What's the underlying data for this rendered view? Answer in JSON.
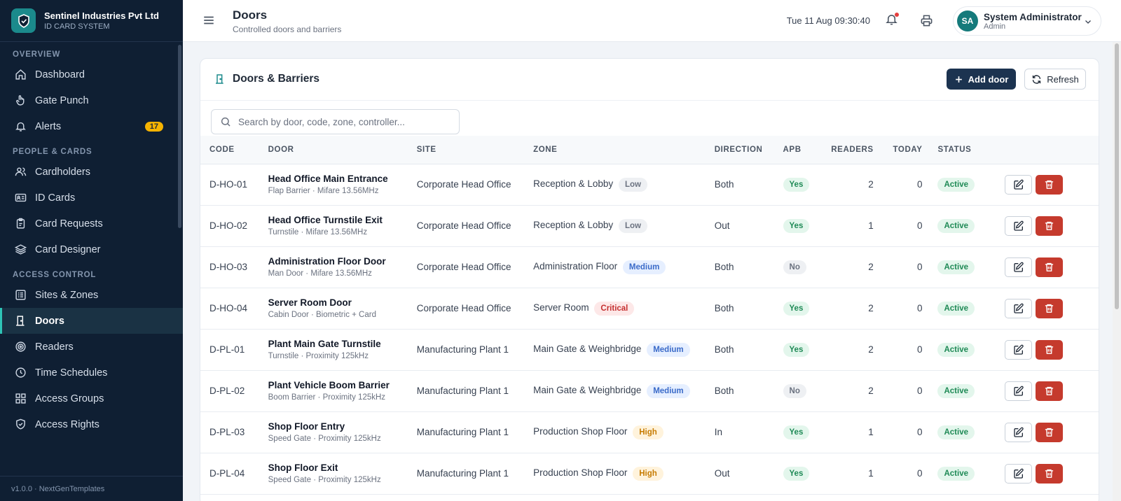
{
  "brand": {
    "name": "Sentinel Industries Pvt Ltd",
    "sub": "ID CARD SYSTEM"
  },
  "sidebar": {
    "sections": {
      "overview": "OVERVIEW",
      "people": "PEOPLE & CARDS",
      "access": "ACCESS CONTROL"
    },
    "items": {
      "dashboard": "Dashboard",
      "gate_punch": "Gate Punch",
      "alerts": "Alerts",
      "alerts_count": "17",
      "cardholders": "Cardholders",
      "id_cards": "ID Cards",
      "card_requests": "Card Requests",
      "card_designer": "Card Designer",
      "sites_zones": "Sites & Zones",
      "doors": "Doors",
      "readers": "Readers",
      "time_schedules": "Time Schedules",
      "access_groups": "Access Groups",
      "access_rights": "Access Rights"
    },
    "footer": "v1.0.0 · NextGenTemplates"
  },
  "header": {
    "title": "Doors",
    "subtitle": "Controlled doors and barriers",
    "datetime": "Tue 11 Aug 09:30:40",
    "user_initials": "SA",
    "user_name": "System Administrator",
    "user_role": "Admin"
  },
  "card": {
    "title": "Doors & Barriers",
    "add_label": "Add door",
    "refresh_label": "Refresh",
    "search_placeholder": "Search by door, code, zone, controller..."
  },
  "table": {
    "columns": {
      "code": "CODE",
      "door": "DOOR",
      "site": "SITE",
      "zone": "ZONE",
      "direction": "DIRECTION",
      "apb": "APB",
      "readers": "READERS",
      "today": "TODAY",
      "status": "STATUS"
    },
    "rows": [
      {
        "code": "D-HO-01",
        "name": "Head Office Main Entrance",
        "meta": "Flap Barrier · Mifare 13.56MHz",
        "site": "Corporate Head Office",
        "zone": "Reception & Lobby",
        "risk": "Low",
        "direction": "Both",
        "apb": "Yes",
        "readers": "2",
        "today": "0",
        "status": "Active"
      },
      {
        "code": "D-HO-02",
        "name": "Head Office Turnstile Exit",
        "meta": "Turnstile · Mifare 13.56MHz",
        "site": "Corporate Head Office",
        "zone": "Reception & Lobby",
        "risk": "Low",
        "direction": "Out",
        "apb": "Yes",
        "readers": "1",
        "today": "0",
        "status": "Active"
      },
      {
        "code": "D-HO-03",
        "name": "Administration Floor Door",
        "meta": "Man Door · Mifare 13.56MHz",
        "site": "Corporate Head Office",
        "zone": "Administration Floor",
        "risk": "Medium",
        "direction": "Both",
        "apb": "No",
        "readers": "2",
        "today": "0",
        "status": "Active"
      },
      {
        "code": "D-HO-04",
        "name": "Server Room Door",
        "meta": "Cabin Door · Biometric + Card",
        "site": "Corporate Head Office",
        "zone": "Server Room",
        "risk": "Critical",
        "direction": "Both",
        "apb": "Yes",
        "readers": "2",
        "today": "0",
        "status": "Active"
      },
      {
        "code": "D-PL-01",
        "name": "Plant Main Gate Turnstile",
        "meta": "Turnstile · Proximity 125kHz",
        "site": "Manufacturing Plant 1",
        "zone": "Main Gate & Weighbridge",
        "risk": "Medium",
        "direction": "Both",
        "apb": "Yes",
        "readers": "2",
        "today": "0",
        "status": "Active"
      },
      {
        "code": "D-PL-02",
        "name": "Plant Vehicle Boom Barrier",
        "meta": "Boom Barrier · Proximity 125kHz",
        "site": "Manufacturing Plant 1",
        "zone": "Main Gate & Weighbridge",
        "risk": "Medium",
        "direction": "Both",
        "apb": "No",
        "readers": "2",
        "today": "0",
        "status": "Active"
      },
      {
        "code": "D-PL-03",
        "name": "Shop Floor Entry",
        "meta": "Speed Gate · Proximity 125kHz",
        "site": "Manufacturing Plant 1",
        "zone": "Production Shop Floor",
        "risk": "High",
        "direction": "In",
        "apb": "Yes",
        "readers": "1",
        "today": "0",
        "status": "Active"
      },
      {
        "code": "D-PL-04",
        "name": "Shop Floor Exit",
        "meta": "Speed Gate · Proximity 125kHz",
        "site": "Manufacturing Plant 1",
        "zone": "Production Shop Floor",
        "risk": "High",
        "direction": "Out",
        "apb": "Yes",
        "readers": "1",
        "today": "0",
        "status": "Active"
      }
    ]
  },
  "colors": {
    "sidebar_bg": "#0f1f33",
    "accent": "#2ec4b6",
    "primary_button": "#1c3350",
    "danger": "#c53a2d",
    "alert_badge": "#f5b301"
  }
}
